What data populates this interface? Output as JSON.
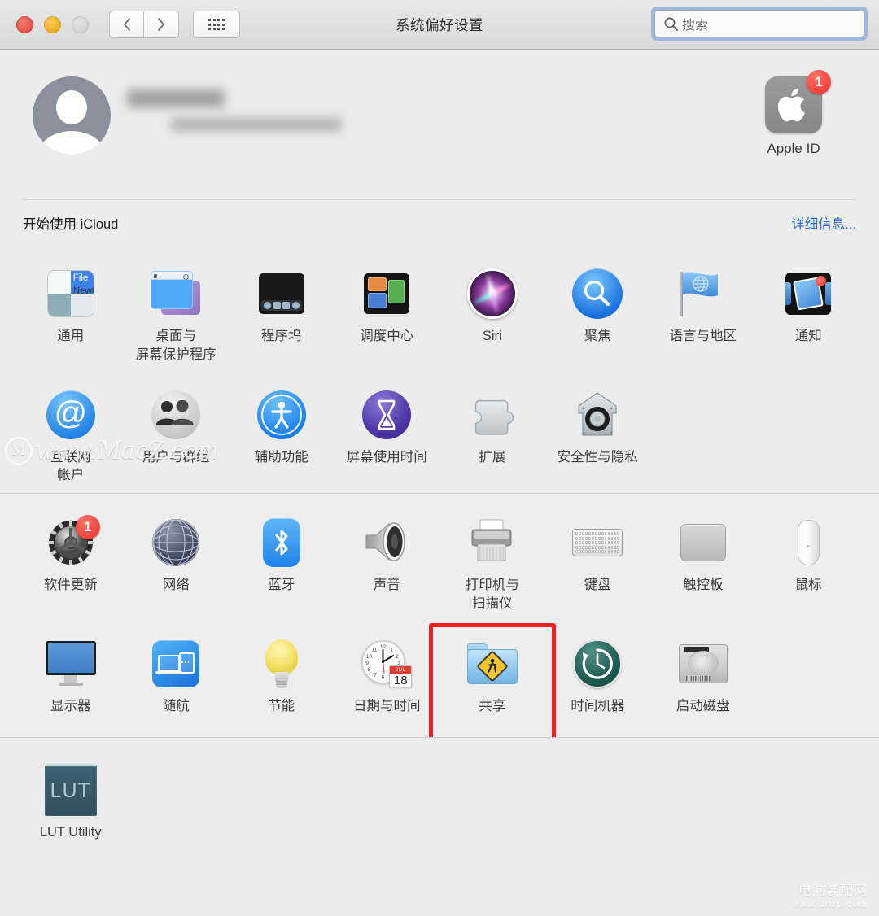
{
  "window": {
    "title": "系统偏好设置",
    "traffic_lights": {
      "close": "close-button",
      "minimize": "minimize-button",
      "zoom": "zoom-button-disabled"
    },
    "nav": {
      "back": "back-button",
      "forward": "forward-button",
      "grid": "show-all-button"
    },
    "search": {
      "placeholder": "搜索",
      "value": ""
    }
  },
  "account": {
    "name_redacted": "",
    "email_redacted": "",
    "apple_id_label": "Apple ID",
    "apple_id_badge": "1"
  },
  "icloud_bar": {
    "text": "开始使用 iCloud",
    "link": "详细信息..."
  },
  "sections": [
    {
      "id": "personal",
      "rows": [
        [
          {
            "id": "general",
            "label": "通用",
            "icon": "general-icon"
          },
          {
            "id": "desktop",
            "label": "桌面与\n屏幕保护程序",
            "icon": "desktop-screensaver-icon"
          },
          {
            "id": "dock",
            "label": "程序坞",
            "icon": "dock-icon"
          },
          {
            "id": "mission",
            "label": "调度中心",
            "icon": "mission-control-icon"
          },
          {
            "id": "siri",
            "label": "Siri",
            "icon": "siri-icon"
          },
          {
            "id": "spotlight",
            "label": "聚焦",
            "icon": "spotlight-icon"
          },
          {
            "id": "language",
            "label": "语言与地区",
            "icon": "language-region-icon"
          },
          {
            "id": "notifications",
            "label": "通知",
            "icon": "notifications-icon"
          }
        ],
        [
          {
            "id": "internet",
            "label": "互联网\n帐户",
            "icon": "internet-accounts-icon"
          },
          {
            "id": "users",
            "label": "用户与群组",
            "icon": "users-groups-icon"
          },
          {
            "id": "accessibility",
            "label": "辅助功能",
            "icon": "accessibility-icon"
          },
          {
            "id": "screentime",
            "label": "屏幕使用时间",
            "icon": "screen-time-icon"
          },
          {
            "id": "extensions",
            "label": "扩展",
            "icon": "extensions-icon"
          },
          {
            "id": "security",
            "label": "安全性与隐私",
            "icon": "security-privacy-icon"
          }
        ]
      ]
    },
    {
      "id": "hardware",
      "rows": [
        [
          {
            "id": "softwareupdate",
            "label": "软件更新",
            "icon": "software-update-icon",
            "badge": "1"
          },
          {
            "id": "network",
            "label": "网络",
            "icon": "network-icon"
          },
          {
            "id": "bluetooth",
            "label": "蓝牙",
            "icon": "bluetooth-icon"
          },
          {
            "id": "sound",
            "label": "声音",
            "icon": "sound-icon"
          },
          {
            "id": "printers",
            "label": "打印机与\n扫描仪",
            "icon": "printers-scanners-icon"
          },
          {
            "id": "keyboard",
            "label": "键盘",
            "icon": "keyboard-icon"
          },
          {
            "id": "trackpad",
            "label": "触控板",
            "icon": "trackpad-icon"
          },
          {
            "id": "mouse",
            "label": "鼠标",
            "icon": "mouse-icon"
          }
        ],
        [
          {
            "id": "displays",
            "label": "显示器",
            "icon": "displays-icon"
          },
          {
            "id": "sidecar",
            "label": "随航",
            "icon": "sidecar-icon"
          },
          {
            "id": "energy",
            "label": "节能",
            "icon": "energy-saver-icon"
          },
          {
            "id": "datetime",
            "label": "日期与时间",
            "icon": "date-time-icon",
            "calendar_month": "JUL",
            "calendar_day": "18"
          },
          {
            "id": "sharing",
            "label": "共享",
            "icon": "sharing-icon",
            "selected": true
          },
          {
            "id": "timemachine",
            "label": "时间机器",
            "icon": "time-machine-icon"
          },
          {
            "id": "startupdisk",
            "label": "启动磁盘",
            "icon": "startup-disk-icon"
          }
        ]
      ]
    },
    {
      "id": "third-party",
      "rows": [
        [
          {
            "id": "lututility",
            "label": "LUT Utility",
            "icon": "lut-utility-icon",
            "icon_text": "LUT"
          }
        ]
      ]
    }
  ],
  "watermarks": {
    "macz": "www.MacZ.com",
    "macz_mark": "M",
    "dnzp_cn": "电脑装配网",
    "dnzp_url": "www.dnzp.com"
  },
  "colors": {
    "selection_outline": "#f02020",
    "badge_red": "#e8332a",
    "link_blue": "#2d6cc4",
    "window_bg": "#ececec",
    "search_focus": "#9fb6de"
  }
}
